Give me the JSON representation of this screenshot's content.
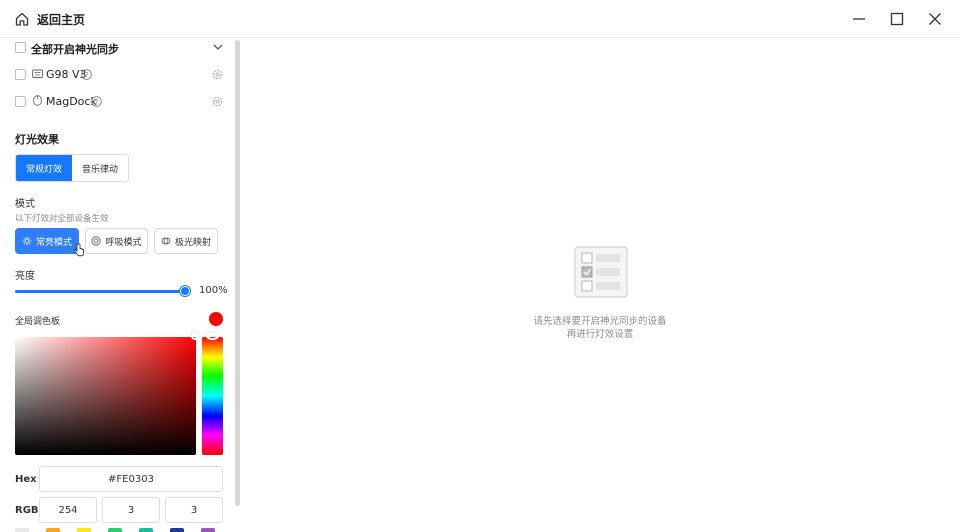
{
  "titlebar": {
    "back_label": "返回主页",
    "icons": [
      "home-icon",
      "minimize-icon",
      "maximize-icon",
      "close-icon"
    ]
  },
  "devices": {
    "all_sync_label": "全部开启神光同步",
    "items": [
      {
        "name": "G98 V3",
        "icon": "keyboard-icon"
      },
      {
        "name": "MagDock",
        "icon": "mouse-icon"
      }
    ]
  },
  "lighting": {
    "title": "灯光效果",
    "tabs": [
      {
        "label": "常规灯效",
        "active": true
      },
      {
        "label": "音乐律动",
        "active": false
      }
    ],
    "mode_label": "模式",
    "mode_hint": "以下灯效对全部设备生效",
    "modes": [
      {
        "label": "常亮模式",
        "active": true,
        "icon": "sun-icon"
      },
      {
        "label": "呼吸模式",
        "active": false,
        "icon": "breath-icon"
      },
      {
        "label": "极光映射",
        "active": false,
        "icon": "aurora-icon"
      }
    ],
    "brightness_label": "亮度",
    "brightness_value": "100%",
    "brightness_level": 1.0,
    "palette_label": "全局调色板",
    "hex_label": "Hex",
    "hex_value": "#FE0303",
    "rgb_label": "RGB",
    "rgb": {
      "r": "254",
      "g": "3",
      "b": "3"
    },
    "current_color": "#FE0303",
    "swatch_colors": [
      "#e8e8e8",
      "#f5a623",
      "#f8e71c",
      "#2ecc71",
      "#1abc9c",
      "#1e3a8a",
      "#9b59b6"
    ]
  },
  "empty_state": {
    "line1": "请先选择要开启神光同步的设备",
    "line2": "再进行灯效设置"
  },
  "colors": {
    "accent": "#1677ff",
    "text": "#222222",
    "muted": "#8c8c8c"
  }
}
